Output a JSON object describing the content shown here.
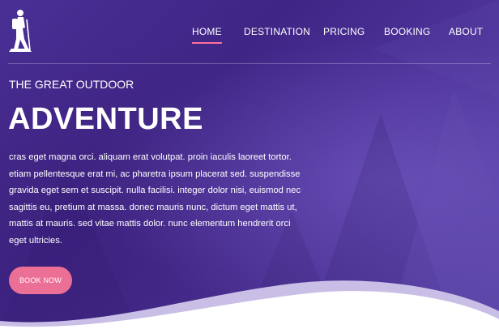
{
  "logo": {
    "icon": "hiker-icon"
  },
  "nav": {
    "items": [
      {
        "label": "HOME",
        "active": true
      },
      {
        "label": "DESTINATION",
        "active": false
      },
      {
        "label": "PRICING",
        "active": false
      },
      {
        "label": "BOOKING",
        "active": false
      },
      {
        "label": "ABOUT",
        "active": false
      }
    ]
  },
  "hero": {
    "tagline": "THE GREAT OUTDOOR",
    "title": "ADVENTURE",
    "body": "cras eget magna orci. aliquam erat volutpat. proin iaculis laoreet tortor. etiam pellentesque erat mi, ac pharetra ipsum placerat sed. suspendisse gravida eget sem et suscipit. nulla facilisi. integer dolor nisi, euismod nec sagittis eu, pretium at massa. donec mauris nunc, dictum eget mattis ut, mattis at mauris. sed vitae mattis dolor. nunc elementum hendrerit orci eget ultricies.",
    "cta_label": "BOOK NOW"
  },
  "colors": {
    "overlay": "#4a2f95",
    "accent_pink": "#ec6f95",
    "nav_underline": "#ff6f9c",
    "wave_light": "#c9bfe6",
    "wave_white": "#ffffff"
  }
}
